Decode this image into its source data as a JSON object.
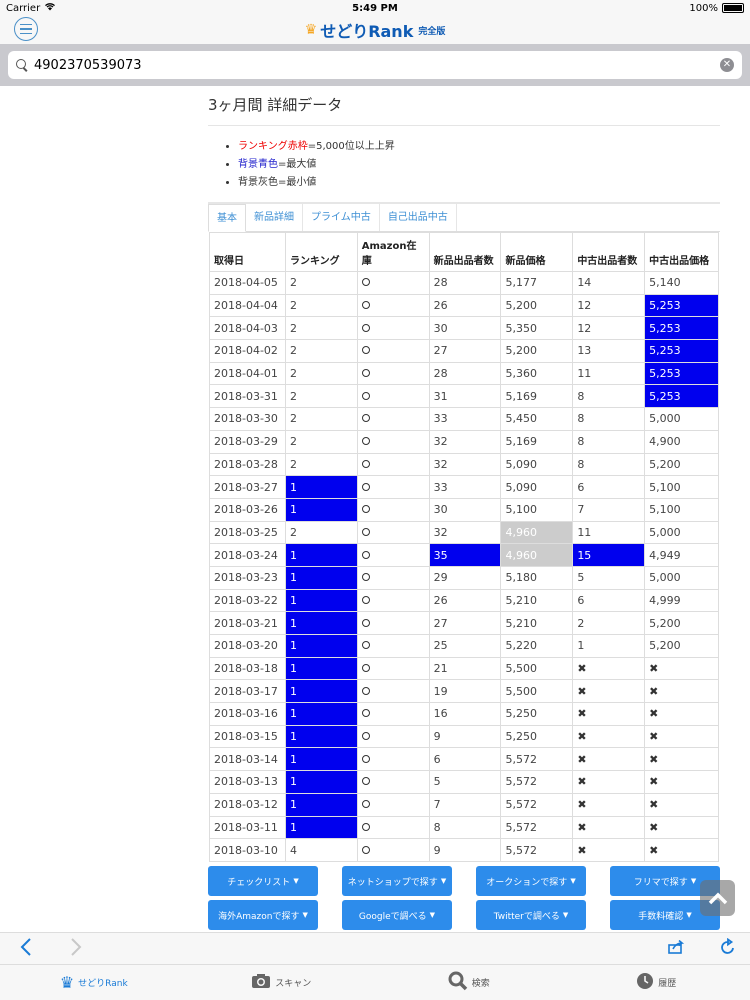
{
  "statusbar": {
    "carrier": "Carrier",
    "time": "5:49 PM",
    "battery": "100%"
  },
  "header": {
    "brand": "せどりRank",
    "edition": "完全版"
  },
  "search": {
    "value": "4902370539073"
  },
  "page": {
    "title": "3ヶ月間 詳細データ",
    "legend": [
      {
        "highlight": "ランキング赤枠",
        "rest": "=5,000位以上上昇"
      },
      {
        "highlight": "背景青色",
        "rest": "=最大値"
      },
      {
        "highlight": "",
        "rest": "背景灰色=最小値"
      }
    ],
    "tabs": [
      "基本",
      "新品詳細",
      "プライム中古",
      "自己出品中古"
    ],
    "table": {
      "headers": [
        "取得日",
        "ランキング",
        "Amazon在庫",
        "新品出品者数",
        "新品価格",
        "中古出品者数",
        "中古出品価格"
      ],
      "rows": [
        [
          "2018-04-05",
          "2",
          "○",
          "28",
          "5,177",
          "14",
          "5,140"
        ],
        [
          "2018-04-04",
          "2",
          "○",
          "26",
          "5,200",
          "12",
          "5,253"
        ],
        [
          "2018-04-03",
          "2",
          "○",
          "30",
          "5,350",
          "12",
          "5,253"
        ],
        [
          "2018-04-02",
          "2",
          "○",
          "27",
          "5,200",
          "13",
          "5,253"
        ],
        [
          "2018-04-01",
          "2",
          "○",
          "28",
          "5,360",
          "11",
          "5,253"
        ],
        [
          "2018-03-31",
          "2",
          "○",
          "31",
          "5,169",
          "8",
          "5,253"
        ],
        [
          "2018-03-30",
          "2",
          "○",
          "33",
          "5,450",
          "8",
          "5,000"
        ],
        [
          "2018-03-29",
          "2",
          "○",
          "32",
          "5,169",
          "8",
          "4,900"
        ],
        [
          "2018-03-28",
          "2",
          "○",
          "32",
          "5,090",
          "8",
          "5,200"
        ],
        [
          "2018-03-27",
          "1",
          "○",
          "33",
          "5,090",
          "6",
          "5,100"
        ],
        [
          "2018-03-26",
          "1",
          "○",
          "30",
          "5,100",
          "7",
          "5,100"
        ],
        [
          "2018-03-25",
          "2",
          "○",
          "32",
          "4,960",
          "11",
          "5,000"
        ],
        [
          "2018-03-24",
          "1",
          "○",
          "35",
          "4,960",
          "15",
          "4,949"
        ],
        [
          "2018-03-23",
          "1",
          "○",
          "29",
          "5,180",
          "5",
          "5,000"
        ],
        [
          "2018-03-22",
          "1",
          "○",
          "26",
          "5,210",
          "6",
          "4,999"
        ],
        [
          "2018-03-21",
          "1",
          "○",
          "27",
          "5,210",
          "2",
          "5,200"
        ],
        [
          "2018-03-20",
          "1",
          "○",
          "25",
          "5,220",
          "1",
          "5,200"
        ],
        [
          "2018-03-18",
          "1",
          "○",
          "21",
          "5,500",
          "✖",
          "✖"
        ],
        [
          "2018-03-17",
          "1",
          "○",
          "19",
          "5,500",
          "✖",
          "✖"
        ],
        [
          "2018-03-16",
          "1",
          "○",
          "16",
          "5,250",
          "✖",
          "✖"
        ],
        [
          "2018-03-15",
          "1",
          "○",
          "9",
          "5,250",
          "✖",
          "✖"
        ],
        [
          "2018-03-14",
          "1",
          "○",
          "6",
          "5,572",
          "✖",
          "✖"
        ],
        [
          "2018-03-13",
          "1",
          "○",
          "5",
          "5,572",
          "✖",
          "✖"
        ],
        [
          "2018-03-12",
          "1",
          "○",
          "7",
          "5,572",
          "✖",
          "✖"
        ],
        [
          "2018-03-11",
          "1",
          "○",
          "8",
          "5,572",
          "✖",
          "✖"
        ],
        [
          "2018-03-10",
          "4",
          "○",
          "9",
          "5,572",
          "✖",
          "✖"
        ]
      ],
      "highlights": {
        "blue": [
          "1-6",
          "2-6",
          "3-6",
          "4-6",
          "5-6",
          "9-1",
          "10-1",
          "12-1",
          "12-3",
          "12-5",
          "13-1",
          "14-1",
          "15-1",
          "16-1",
          "17-1",
          "18-1",
          "19-1",
          "20-1",
          "21-1",
          "22-1",
          "23-1",
          "24-1"
        ],
        "gray": [
          "11-4",
          "12-4"
        ]
      }
    }
  },
  "actions": [
    [
      "チェックリスト",
      "ネットショップで探す",
      "オークションで探す",
      "フリマで探す"
    ],
    [
      "海外Amazonで探す",
      "Googleで調べる",
      "Twitterで調べる",
      "手数料確認"
    ]
  ],
  "tabbar": [
    "せどりRank",
    "スキャン",
    "検索",
    "履歴"
  ],
  "colors": {
    "accent": "#2d8ceb",
    "max": "#0000ee",
    "min": "#cccccc"
  }
}
